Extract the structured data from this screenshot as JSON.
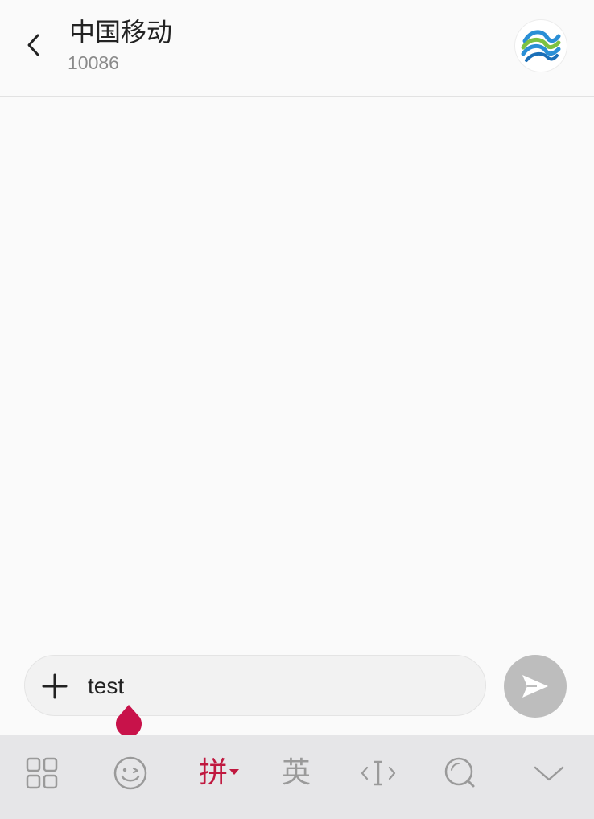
{
  "header": {
    "contact_name": "中国移动",
    "contact_number": "10086",
    "back_icon": "chevron-left-icon",
    "avatar_icon": "china-mobile-logo-icon"
  },
  "composer": {
    "add_icon": "plus-icon",
    "message_text": "test",
    "send_icon": "send-icon"
  },
  "keyboard_toolbar": {
    "items": [
      {
        "icon": "apps-grid-icon"
      },
      {
        "icon": "emoji-icon"
      },
      {
        "label": "拼",
        "active": true
      },
      {
        "label": "英"
      },
      {
        "icon": "cursor-move-icon"
      },
      {
        "icon": "search-icon"
      },
      {
        "icon": "chevron-down-icon"
      }
    ]
  },
  "colors": {
    "accent": "#c0183f",
    "background": "#fafafa",
    "toolbar_background": "#e6e6e8",
    "send_button": "#bdbdbd",
    "icon_gray": "#9a9a9a"
  }
}
